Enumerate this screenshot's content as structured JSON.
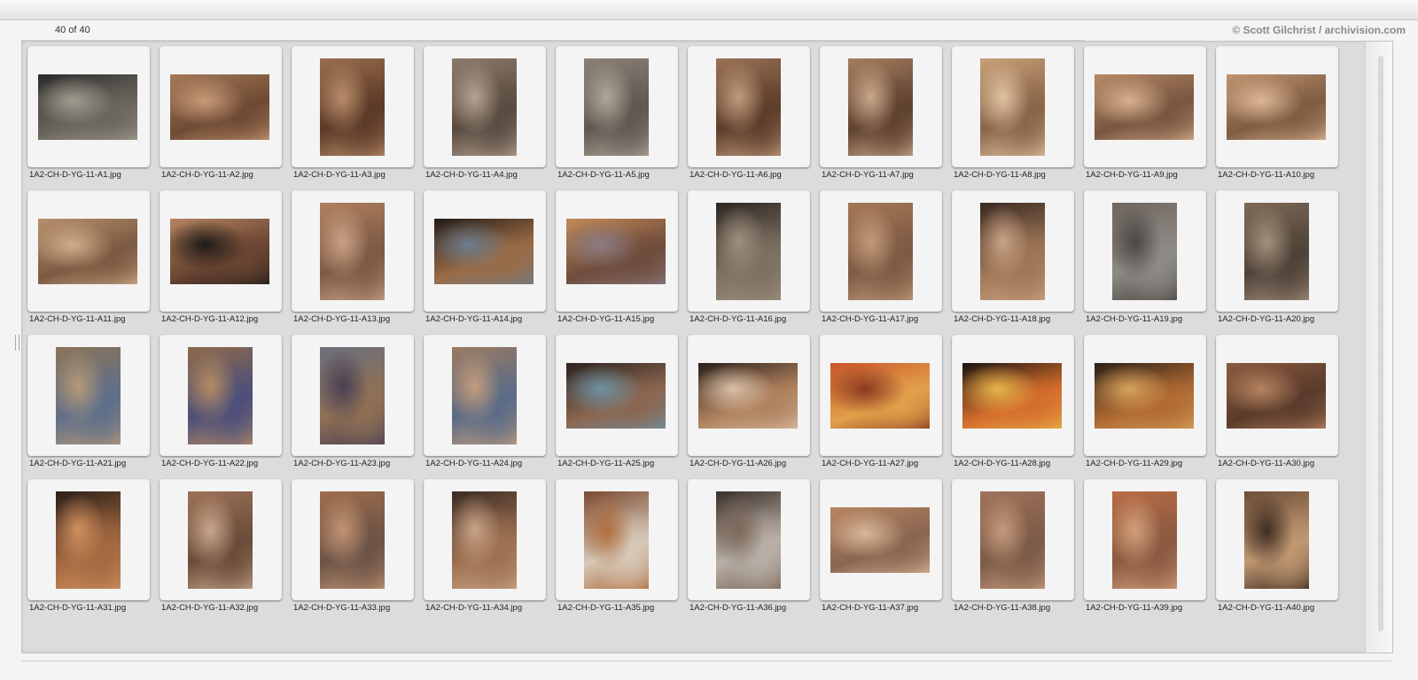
{
  "header": {
    "counter": "40 of 40",
    "copyright": "© Scott Gilchrist / archivision.com"
  },
  "images": [
    {
      "file": "1A2-CH-D-YG-11-A1.jpg",
      "orientation": "land",
      "colors": [
        "#2a2a2a",
        "#6a655c",
        "#a29c90"
      ]
    },
    {
      "file": "1A2-CH-D-YG-11-A2.jpg",
      "orientation": "land",
      "colors": [
        "#a57a58",
        "#6f4a33",
        "#c79b77"
      ]
    },
    {
      "file": "1A2-CH-D-YG-11-A3.jpg",
      "orientation": "port",
      "colors": [
        "#9a6e4e",
        "#5b3a27",
        "#b98d6b"
      ]
    },
    {
      "file": "1A2-CH-D-YG-11-A4.jpg",
      "orientation": "port",
      "colors": [
        "#8d7a6b",
        "#5a4b40",
        "#b3a294"
      ]
    },
    {
      "file": "1A2-CH-D-YG-11-A5.jpg",
      "orientation": "port",
      "colors": [
        "#8b8177",
        "#615850",
        "#b0a69b"
      ]
    },
    {
      "file": "1A2-CH-D-YG-11-A6.jpg",
      "orientation": "port",
      "colors": [
        "#9a7257",
        "#5d3e2b",
        "#c19a7d"
      ]
    },
    {
      "file": "1A2-CH-D-YG-11-A7.jpg",
      "orientation": "port",
      "colors": [
        "#a37d5f",
        "#5f4230",
        "#c9a88b"
      ]
    },
    {
      "file": "1A2-CH-D-YG-11-A8.jpg",
      "orientation": "port",
      "colors": [
        "#c7a078",
        "#8a6548",
        "#e0c2a2"
      ]
    },
    {
      "file": "1A2-CH-D-YG-11-A9.jpg",
      "orientation": "land",
      "colors": [
        "#b68a65",
        "#7a5640",
        "#d6b08d"
      ]
    },
    {
      "file": "1A2-CH-D-YG-11-A10.jpg",
      "orientation": "land",
      "colors": [
        "#c09470",
        "#805c42",
        "#ddb896"
      ]
    },
    {
      "file": "1A2-CH-D-YG-11-A11.jpg",
      "orientation": "land",
      "colors": [
        "#b7906d",
        "#7c5a41",
        "#d2ad8c"
      ]
    },
    {
      "file": "1A2-CH-D-YG-11-A12.jpg",
      "orientation": "land",
      "colors": [
        "#b58461",
        "#6a4532",
        "#1f1a17"
      ]
    },
    {
      "file": "1A2-CH-D-YG-11-A13.jpg",
      "orientation": "port",
      "colors": [
        "#b07f5e",
        "#7d5a45",
        "#caa285"
      ]
    },
    {
      "file": "1A2-CH-D-YG-11-A14.jpg",
      "orientation": "land",
      "colors": [
        "#231b16",
        "#9a6b45",
        "#6d7d8f"
      ]
    },
    {
      "file": "1A2-CH-D-YG-11-A15.jpg",
      "orientation": "land",
      "colors": [
        "#c48a57",
        "#6f4c3b",
        "#8a7a82"
      ]
    },
    {
      "file": "1A2-CH-D-YG-11-A16.jpg",
      "orientation": "port",
      "colors": [
        "#2c2622",
        "#7c7062",
        "#9f8f7c"
      ]
    },
    {
      "file": "1A2-CH-D-YG-11-A17.jpg",
      "orientation": "port",
      "colors": [
        "#a47755",
        "#7d5a44",
        "#c39b7a"
      ]
    },
    {
      "file": "1A2-CH-D-YG-11-A18.jpg",
      "orientation": "port",
      "colors": [
        "#3a2a22",
        "#9e7656",
        "#c8a283"
      ]
    },
    {
      "file": "1A2-CH-D-YG-11-A19.jpg",
      "orientation": "port",
      "colors": [
        "#6f6660",
        "#8e8a86",
        "#4b4642"
      ]
    },
    {
      "file": "1A2-CH-D-YG-11-A20.jpg",
      "orientation": "port",
      "colors": [
        "#7d6a58",
        "#4f4339",
        "#a48f7b"
      ]
    },
    {
      "file": "1A2-CH-D-YG-11-A21.jpg",
      "orientation": "port",
      "colors": [
        "#8b7458",
        "#5f6f8a",
        "#b59978"
      ]
    },
    {
      "file": "1A2-CH-D-YG-11-A22.jpg",
      "orientation": "port",
      "colors": [
        "#8e6a4b",
        "#4d4f7a",
        "#b48b63"
      ]
    },
    {
      "file": "1A2-CH-D-YG-11-A23.jpg",
      "orientation": "port",
      "colors": [
        "#6b6f7c",
        "#8f7055",
        "#4a3f52"
      ]
    },
    {
      "file": "1A2-CH-D-YG-11-A24.jpg",
      "orientation": "port",
      "colors": [
        "#9a7a62",
        "#5c6c86",
        "#c29c7d"
      ]
    },
    {
      "file": "1A2-CH-D-YG-11-A25.jpg",
      "orientation": "land",
      "colors": [
        "#2a211d",
        "#8b6650",
        "#6e92a4"
      ]
    },
    {
      "file": "1A2-CH-D-YG-11-A26.jpg",
      "orientation": "land",
      "colors": [
        "#2a1f1a",
        "#b0825e",
        "#d9c0a6"
      ]
    },
    {
      "file": "1A2-CH-D-YG-11-A27.jpg",
      "orientation": "land",
      "colors": [
        "#c9542a",
        "#e2a04a",
        "#8a3a20"
      ]
    },
    {
      "file": "1A2-CH-D-YG-11-A28.jpg",
      "orientation": "land",
      "colors": [
        "#1a1410",
        "#d46d2c",
        "#e8b54a"
      ]
    },
    {
      "file": "1A2-CH-D-YG-11-A29.jpg",
      "orientation": "land",
      "colors": [
        "#2a1f18",
        "#b06a33",
        "#d6a35a"
      ]
    },
    {
      "file": "1A2-CH-D-YG-11-A30.jpg",
      "orientation": "land",
      "colors": [
        "#8a5a3e",
        "#5a3b2b",
        "#b5825f"
      ]
    },
    {
      "file": "1A2-CH-D-YG-11-A31.jpg",
      "orientation": "port",
      "colors": [
        "#2a1e18",
        "#a2683f",
        "#d09060"
      ]
    },
    {
      "file": "1A2-CH-D-YG-11-A32.jpg",
      "orientation": "port",
      "colors": [
        "#9c7257",
        "#6b4d3b",
        "#c7a68a"
      ]
    },
    {
      "file": "1A2-CH-D-YG-11-A33.jpg",
      "orientation": "port",
      "colors": [
        "#a06d4c",
        "#6d5446",
        "#c29474"
      ]
    },
    {
      "file": "1A2-CH-D-YG-11-A34.jpg",
      "orientation": "port",
      "colors": [
        "#3a2c24",
        "#9d7051",
        "#c9a386"
      ]
    },
    {
      "file": "1A2-CH-D-YG-11-A35.jpg",
      "orientation": "port",
      "colors": [
        "#7a4a30",
        "#d6c8b8",
        "#b06d3e"
      ]
    },
    {
      "file": "1A2-CH-D-YG-11-A36.jpg",
      "orientation": "port",
      "colors": [
        "#3a2f2a",
        "#b8b0a8",
        "#7d6858"
      ]
    },
    {
      "file": "1A2-CH-D-YG-11-A37.jpg",
      "orientation": "land",
      "colors": [
        "#b88560",
        "#8a6650",
        "#d9b799"
      ]
    },
    {
      "file": "1A2-CH-D-YG-11-A38.jpg",
      "orientation": "port",
      "colors": [
        "#a0735a",
        "#7c5b47",
        "#c59a7d"
      ]
    },
    {
      "file": "1A2-CH-D-YG-11-A39.jpg",
      "orientation": "port",
      "colors": [
        "#b86c43",
        "#8c5a42",
        "#d1a07a"
      ]
    },
    {
      "file": "1A2-CH-D-YG-11-A40.jpg",
      "orientation": "port",
      "colors": [
        "#6e4e38",
        "#bf9770",
        "#3d2c22"
      ]
    }
  ]
}
